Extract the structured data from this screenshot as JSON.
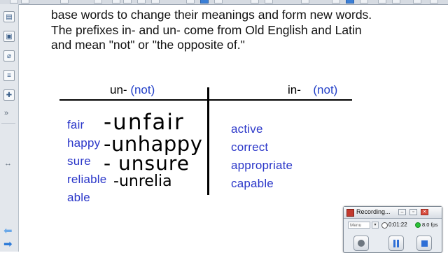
{
  "paragraph": {
    "line1": "base words to change their meanings and form new words.",
    "line2": "The prefixes in- and un- come from Old English and Latin",
    "line3": "and mean \"not\" or \"the opposite of.\""
  },
  "table": {
    "left_header": {
      "prefix": "un-",
      "meaning": "(not)"
    },
    "right_header": {
      "prefix": "in-",
      "meaning": "(not)"
    },
    "left_words": [
      "fair",
      "happy",
      "sure",
      "reliable",
      "able"
    ],
    "right_words": [
      "active",
      "correct",
      "appropriate",
      "capable"
    ],
    "handwritten": [
      "-unfair",
      "-unhappy",
      "- unsure",
      "-unrelia"
    ]
  },
  "recorder": {
    "title": "Recording...",
    "menu_label": "Menu",
    "timer": "0:01:22",
    "fps": "8.0 fps",
    "colors": {
      "status": "#29c236",
      "accent": "#2e6fd6",
      "record": "#c23a2f"
    }
  },
  "icons": {
    "side": [
      "page-sorter-icon",
      "gallery-icon",
      "attachments-icon",
      "properties-icon",
      "addons-icon"
    ],
    "nav": [
      "back-arrow-icon",
      "forward-arrow-icon"
    ]
  },
  "colors": {
    "word_blue": "#2b37c9",
    "paren_blue": "#2340c8"
  }
}
